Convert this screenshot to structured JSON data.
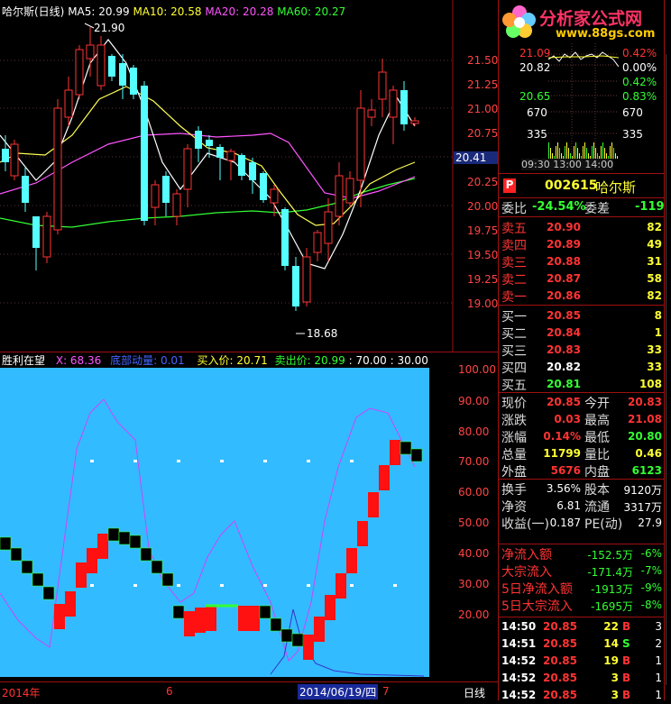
{
  "main_chart": {
    "title": "哈尔斯(日线)",
    "ma5_label": "MA5: 20.99",
    "ma10_label": "MA10: 20.58",
    "ma20_label": "MA20: 20.28",
    "ma60_label": "MA60: 20.27",
    "high_marker": "21.90",
    "low_marker": "18.68",
    "current_price_tag": "20.41",
    "y_ticks": [
      "21.50",
      "21.25",
      "21.00",
      "20.75",
      "20.25",
      "20.00",
      "19.75",
      "19.50",
      "19.25",
      "19.00"
    ],
    "colors": {
      "ma5": "#ffffff",
      "ma10": "#ffff55",
      "ma20": "#ff55ff",
      "ma60": "#33ff33",
      "up": "#ff3333",
      "down": "#55ffff"
    }
  },
  "indicator": {
    "name": "胜利在望",
    "x_label": "X: 68.36",
    "bottom_label": "底部动量: 0.01",
    "buy_label": "买入价: 20.71",
    "sell_label": "卖出价: 20.99",
    "extra1": ": 70.00",
    "extra2": ": 30.00",
    "y_ticks": [
      "100.00",
      "90.00",
      "80.00",
      "70.00",
      "60.00",
      "50.00",
      "40.00",
      "30.00",
      "20.00"
    ],
    "bg": "#33bbff"
  },
  "time_axis": {
    "labels": [
      "2014年",
      "6",
      "2014/06/19/四",
      "7"
    ],
    "period": "日线"
  },
  "brand": {
    "logo_text": "分析家公式网",
    "url": "www.88gs.com"
  },
  "intraday": {
    "prices": [
      "21.09",
      "20.82",
      "20.65"
    ],
    "pcts": [
      "0.42%",
      "0.00%",
      "0.42%",
      "0.83%"
    ],
    "vols": [
      "670",
      "335",
      "670",
      "335"
    ],
    "time_label": "09:30 13:00 14:00"
  },
  "quote": {
    "p_badge": "P",
    "code": "002615",
    "name": "哈尔斯",
    "weibi_label": "委比",
    "weibi_value": "-24.54%",
    "weicha_label": "委差",
    "weicha_value": "-119",
    "asks": [
      {
        "label": "卖五",
        "price": "20.90",
        "vol": "82"
      },
      {
        "label": "卖四",
        "price": "20.89",
        "vol": "49"
      },
      {
        "label": "卖三",
        "price": "20.88",
        "vol": "31"
      },
      {
        "label": "卖二",
        "price": "20.87",
        "vol": "58"
      },
      {
        "label": "卖一",
        "price": "20.86",
        "vol": "82"
      }
    ],
    "bids": [
      {
        "label": "买一",
        "price": "20.85",
        "vol": "8"
      },
      {
        "label": "买二",
        "price": "20.84",
        "vol": "1"
      },
      {
        "label": "买三",
        "price": "20.83",
        "vol": "33"
      },
      {
        "label": "买四",
        "price": "20.82",
        "vol": "33"
      },
      {
        "label": "买五",
        "price": "20.81",
        "vol": "108"
      }
    ],
    "stats": [
      {
        "l1": "现价",
        "v1": "20.85",
        "l2": "今开",
        "v2": "20.83"
      },
      {
        "l1": "涨跌",
        "v1": "0.03",
        "l2": "最高",
        "v2": "21.08"
      },
      {
        "l1": "涨幅",
        "v1": "0.14%",
        "l2": "最低",
        "v2": "20.80"
      },
      {
        "l1": "总量",
        "v1": "11799",
        "l2": "量比",
        "v2": "0.46"
      },
      {
        "l1": "外盘",
        "v1": "5676",
        "l2": "内盘",
        "v2": "6123"
      }
    ],
    "fund": [
      {
        "l1": "换手",
        "v1": "3.56%",
        "l2": "股本",
        "v2": "9120万"
      },
      {
        "l1": "净资",
        "v1": "6.81",
        "l2": "流通",
        "v2": "3317万"
      },
      {
        "l1": "收益(一)",
        "v1": "0.187",
        "l2": "PE(动)",
        "v2": "27.9"
      }
    ],
    "flows": [
      {
        "label": "净流入额",
        "value": "-152.5万",
        "pct": "-6%"
      },
      {
        "label": "大宗流入",
        "value": "-171.4万",
        "pct": "-7%"
      },
      {
        "label": "5日净流入额",
        "value": "-1913万",
        "pct": "-9%"
      },
      {
        "label": "5日大宗流入",
        "value": "-1695万",
        "pct": "-8%"
      }
    ],
    "ticks": [
      {
        "time": "14:50",
        "price": "20.85",
        "vol": "22",
        "side": "B",
        "n": "3"
      },
      {
        "time": "14:51",
        "price": "20.85",
        "vol": "14",
        "side": "S",
        "n": "2"
      },
      {
        "time": "14:52",
        "price": "20.85",
        "vol": "19",
        "side": "B",
        "n": "1"
      },
      {
        "time": "14:52",
        "price": "20.85",
        "vol": "3",
        "side": "B",
        "n": "1"
      },
      {
        "time": "14:52",
        "price": "20.85",
        "vol": "3",
        "side": "B",
        "n": "1"
      }
    ]
  }
}
